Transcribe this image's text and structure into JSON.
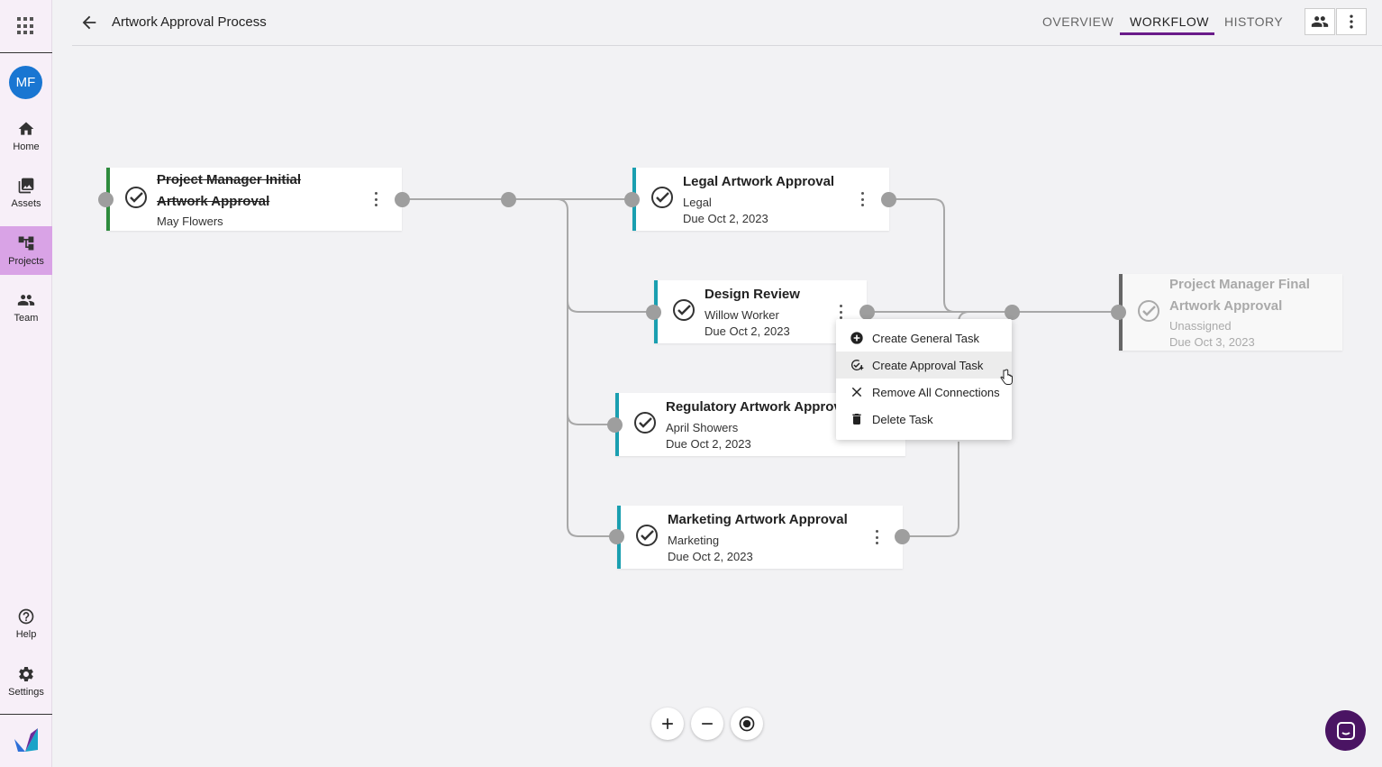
{
  "sidebar": {
    "avatar_initials": "MF",
    "items": [
      {
        "label": "Home",
        "icon": "home-icon"
      },
      {
        "label": "Assets",
        "icon": "gallery-icon"
      },
      {
        "label": "Projects",
        "icon": "projects-icon",
        "active": true
      },
      {
        "label": "Team",
        "icon": "team-icon"
      },
      {
        "label": "Help",
        "icon": "help-icon"
      },
      {
        "label": "Settings",
        "icon": "gear-icon"
      }
    ]
  },
  "header": {
    "title": "Artwork Approval Process",
    "tabs": [
      {
        "label": "OVERVIEW"
      },
      {
        "label": "WORKFLOW",
        "active": true
      },
      {
        "label": "HISTORY"
      }
    ]
  },
  "workflow": {
    "nodes": [
      {
        "title_line1": "Project Manager Initial",
        "title_line2": "Artwork Approval",
        "assignee": "May Flowers",
        "status": "completed"
      },
      {
        "title": "Legal Artwork Approval",
        "assignee": "Legal",
        "due": "Due Oct 2, 2023"
      },
      {
        "title": "Design Review",
        "assignee": "Willow Worker",
        "due": "Due Oct 2, 2023"
      },
      {
        "title": "Regulatory Artwork Approv",
        "assignee": "April Showers",
        "due": "Due Oct 2, 2023"
      },
      {
        "title": "Marketing Artwork Approval",
        "assignee": "Marketing",
        "due": "Due Oct 2, 2023"
      },
      {
        "title_line1": "Project Manager Final",
        "title_line2": "Artwork Approval",
        "assignee": "Unassigned",
        "due": "Due Oct 3, 2023",
        "status": "inactive"
      }
    ]
  },
  "context_menu": {
    "items": [
      {
        "label": "Create General Task",
        "icon": "plus-circle-icon"
      },
      {
        "label": "Create Approval Task",
        "icon": "check-circle-icon"
      },
      {
        "label": "Remove All Connections",
        "icon": "close-icon"
      },
      {
        "label": "Delete Task",
        "icon": "trash-icon"
      }
    ]
  },
  "colors": {
    "accent": "#6a1b8a",
    "task_border": "#1a9fb0",
    "completed_border": "#2e8b3d",
    "sidebar_active": "#d9a3e6",
    "avatar": "#1976d2",
    "chat_button": "#4a1463"
  }
}
